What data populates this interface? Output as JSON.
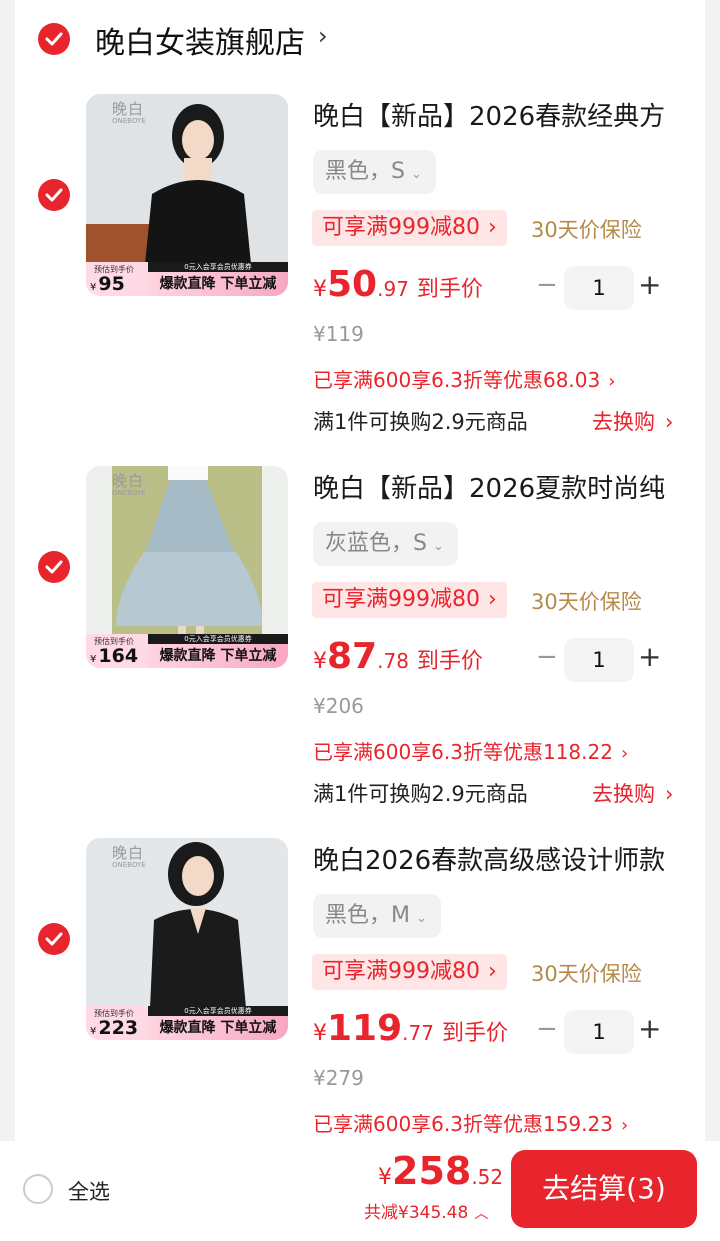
{
  "store": {
    "name": "晚白女装旗舰店",
    "arrow": "›"
  },
  "items": [
    {
      "title": "晚白【新品】2026春款经典方",
      "sku": "黑色，S",
      "promo": "可享满999减80",
      "insurance": "30天价保险",
      "price_currency": "¥",
      "price_int": "50",
      "price_dec": ".97",
      "price_label": "到手价",
      "qty": "1",
      "original_price": "¥119",
      "discount": "已享满600享6.3折等优惠68.03",
      "exchange": "满1件可换购2.9元商品",
      "exchange_link": "去换购",
      "thumb_logo": "晚白",
      "thumb_logo_sub": "ONEBOYE",
      "thumb_est_label": "预估到手价",
      "thumb_est_currency": "¥",
      "thumb_est_price": "95",
      "thumb_strip_top": "0元入会享会员优惠券",
      "thumb_strip_main": "爆款直降 下单立减"
    },
    {
      "title": "晚白【新品】2026夏款时尚纯",
      "sku": "灰蓝色，S",
      "promo": "可享满999减80",
      "insurance": "30天价保险",
      "price_currency": "¥",
      "price_int": "87",
      "price_dec": ".78",
      "price_label": "到手价",
      "qty": "1",
      "original_price": "¥206",
      "discount": "已享满600享6.3折等优惠118.22",
      "exchange": "满1件可换购2.9元商品",
      "exchange_link": "去换购",
      "thumb_logo": "晚白",
      "thumb_logo_sub": "ONEBOYE",
      "thumb_est_label": "预估到手价",
      "thumb_est_currency": "¥",
      "thumb_est_price": "164",
      "thumb_strip_top": "0元入会享会员优惠券",
      "thumb_strip_main": "爆款直降 下单立减"
    },
    {
      "title": "晚白2026春款高级感设计师款",
      "sku": "黑色，M",
      "promo": "可享满999减80",
      "insurance": "30天价保险",
      "price_currency": "¥",
      "price_int": "119",
      "price_dec": ".77",
      "price_label": "到手价",
      "qty": "1",
      "original_price": "¥279",
      "discount": "已享满600享6.3折等优惠159.23",
      "thumb_logo": "晚白",
      "thumb_logo_sub": "ONEBOYE",
      "thumb_est_label": "预估到手价",
      "thumb_est_currency": "¥",
      "thumb_est_price": "223",
      "thumb_strip_top": "0元入会享会员优惠券",
      "thumb_strip_main": "爆款直降 下单立减"
    }
  ],
  "icons": {
    "sku_chevron": "chevron-down-icon",
    "link_chevron": "chevron-right-icon",
    "qty_minus": "−",
    "qty_plus": "+"
  },
  "bottom": {
    "select_all": "全选",
    "total_currency": "¥",
    "total_int": "258",
    "total_dec": ".52",
    "saved": "共减¥345.48",
    "checkout": "去结算(3)"
  },
  "colors": {
    "accent": "#e8242c",
    "insurance": "#b58a48",
    "promo_bg": "#ffe6e6"
  }
}
